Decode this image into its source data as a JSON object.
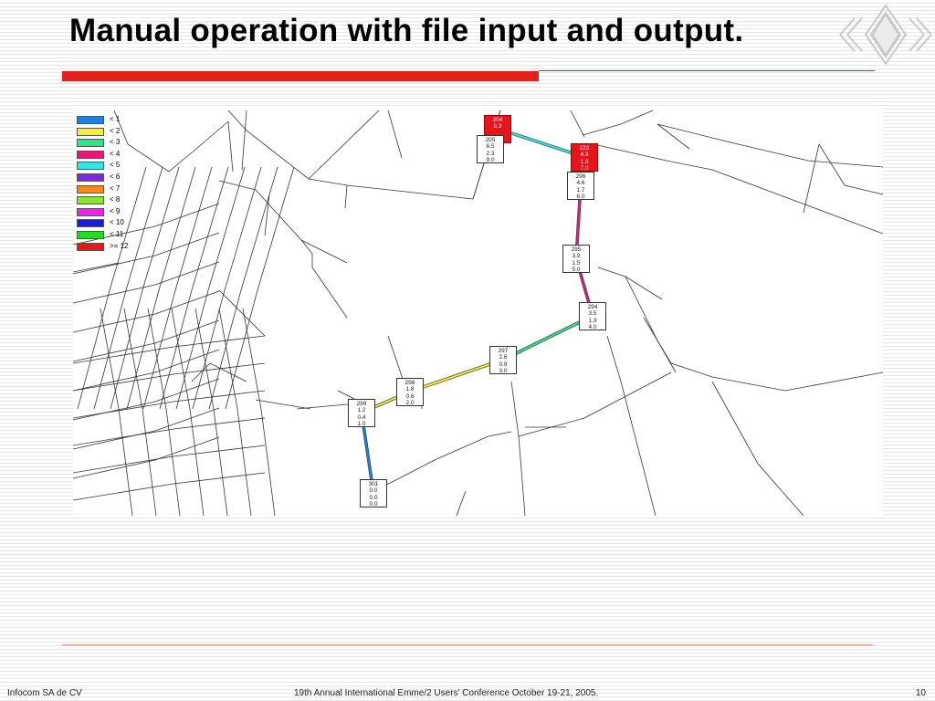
{
  "slide": {
    "title": "Manual operation with file input and output.",
    "footer": {
      "left": "Infocom SA de CV",
      "center": "19th Annual International Emme/2 Users' Conference October 19-21, 2005.",
      "page_number": "10"
    }
  },
  "colors": {
    "accent_red": "#e2211c",
    "node_highlight": "#e8141c",
    "map_lines": "#333333"
  },
  "legend": [
    {
      "label": "< 1",
      "color": "#1a82e6"
    },
    {
      "label": "< 2",
      "color": "#f2f230"
    },
    {
      "label": "< 3",
      "color": "#2ee68a"
    },
    {
      "label": "< 4",
      "color": "#e6197a"
    },
    {
      "label": "< 5",
      "color": "#30e6e6"
    },
    {
      "label": "< 6",
      "color": "#7a2ae6"
    },
    {
      "label": "< 7",
      "color": "#f28a1e"
    },
    {
      "label": "< 8",
      "color": "#8ae632"
    },
    {
      "label": "< 9",
      "color": "#f21ef2"
    },
    {
      "label": "< 10",
      "color": "#1a1ae6"
    },
    {
      "label": "< 11",
      "color": "#22dd22"
    },
    {
      "label": ">= 12",
      "color": "#f21414"
    }
  ],
  "nodes": [
    {
      "id": "204",
      "values": [
        "204",
        "8.3",
        "",
        ""
      ],
      "highlight": true
    },
    {
      "id": "205",
      "values": [
        "205",
        "6.5",
        "2.3",
        "9.0"
      ],
      "highlight": false
    },
    {
      "id": "222",
      "values": [
        "222",
        "4.9",
        "1.8",
        "7.0"
      ],
      "highlight": true
    },
    {
      "id": "296",
      "values": [
        "296",
        "4.6",
        "1.7",
        "6.0"
      ],
      "highlight": false
    },
    {
      "id": "295",
      "values": [
        "295",
        "3.9",
        "1.5",
        "5.0"
      ],
      "highlight": false
    },
    {
      "id": "294",
      "values": [
        "294",
        "3.5",
        "1.3",
        "4.0"
      ],
      "highlight": false
    },
    {
      "id": "297",
      "values": [
        "297",
        "2.6",
        "0.9",
        "3.0"
      ],
      "highlight": false
    },
    {
      "id": "298",
      "values": [
        "298",
        "1.8",
        "0.6",
        "2.0"
      ],
      "highlight": false
    },
    {
      "id": "299",
      "values": [
        "299",
        "1.2",
        "0.4",
        "1.0"
      ],
      "highlight": false
    },
    {
      "id": "301",
      "values": [
        "301",
        "0.0",
        "0.0",
        "0.0"
      ],
      "highlight": false
    }
  ],
  "path_links": [
    {
      "from": "204",
      "to": "222",
      "color": "#30e6e6"
    },
    {
      "from": "222",
      "to": "296",
      "color": "#e6197a"
    },
    {
      "from": "296",
      "to": "295",
      "color": "#e6197a"
    },
    {
      "from": "295",
      "to": "294",
      "color": "#e6197a"
    },
    {
      "from": "294",
      "to": "297",
      "color": "#2ee68a"
    },
    {
      "from": "297",
      "to": "298",
      "color": "#f2f230"
    },
    {
      "from": "298",
      "to": "299",
      "color": "#f2f230"
    },
    {
      "from": "299",
      "to": "301",
      "color": "#1a82e6"
    }
  ]
}
